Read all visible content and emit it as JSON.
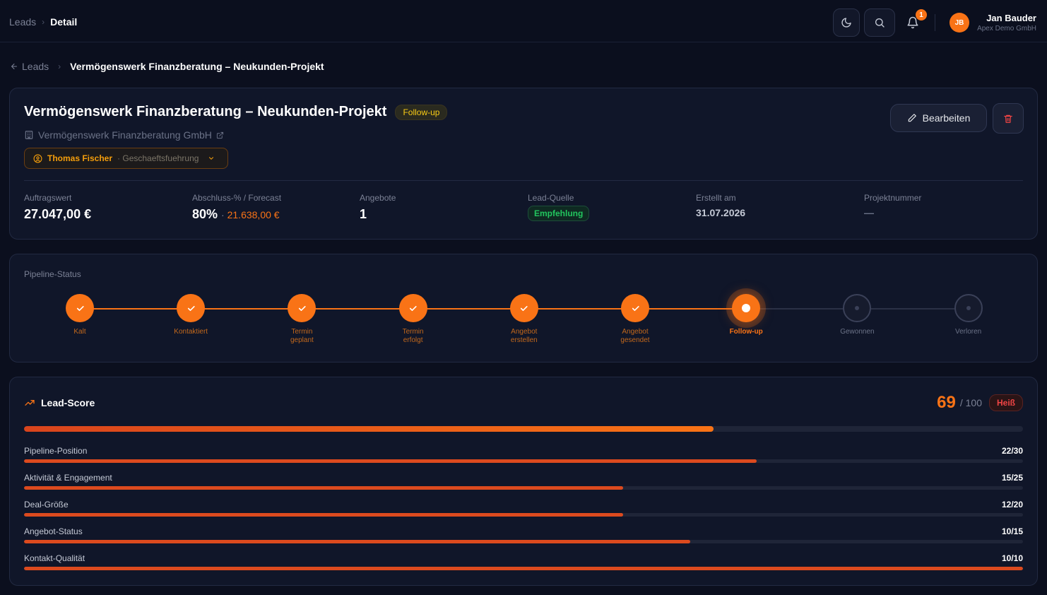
{
  "topbar": {
    "crumb_parent": "Leads",
    "crumb_current": "Detail",
    "notifications_count": "1",
    "user_initials": "JB",
    "user_name": "Jan Bauder",
    "user_company": "Apex Demo GmbH"
  },
  "breadcrumb": {
    "back_label": "Leads",
    "current": "Vermögenswerk Finanzberatung – Neukunden-Projekt"
  },
  "lead": {
    "title": "Vermögenswerk Finanzberatung – Neukunden-Projekt",
    "status": "Follow-up",
    "company": "Vermögenswerk Finanzberatung GmbH",
    "contact_name": "Thomas Fischer",
    "contact_role": "· Geschaeftsfuehrung",
    "edit_label": "Bearbeiten",
    "stats": {
      "auftragswert_label": "Auftragswert",
      "auftragswert": "27.047,00 €",
      "abschluss_label": "Abschluss-% / Forecast",
      "abschluss": "80%",
      "forecast": "21.638,00 €",
      "angebote_label": "Angebote",
      "angebote": "1",
      "quelle_label": "Lead-Quelle",
      "quelle": "Empfehlung",
      "erstellt_label": "Erstellt am",
      "erstellt": "31.07.2026",
      "projektnummer_label": "Projektnummer",
      "projektnummer": "—"
    }
  },
  "pipeline": {
    "label": "Pipeline-Status",
    "stages": [
      {
        "line1": "Kalt",
        "line2": "",
        "state": "done"
      },
      {
        "line1": "Kontaktiert",
        "line2": "",
        "state": "done"
      },
      {
        "line1": "Termin",
        "line2": "geplant",
        "state": "done"
      },
      {
        "line1": "Termin",
        "line2": "erfolgt",
        "state": "done"
      },
      {
        "line1": "Angebot",
        "line2": "erstellen",
        "state": "done"
      },
      {
        "line1": "Angebot",
        "line2": "gesendet",
        "state": "done"
      },
      {
        "line1": "Follow-up",
        "line2": "",
        "state": "current"
      },
      {
        "line1": "Gewonnen",
        "line2": "",
        "state": "todo"
      },
      {
        "line1": "Verloren",
        "line2": "",
        "state": "todo"
      }
    ]
  },
  "lead_score": {
    "title": "Lead-Score",
    "score": "69",
    "max": "/ 100",
    "rating": "Heiß",
    "score_fraction": 0.69,
    "rows": [
      {
        "label": "Pipeline-Position",
        "value": "22/30",
        "fraction": 0.7333
      },
      {
        "label": "Aktivität & Engagement",
        "value": "15/25",
        "fraction": 0.6
      },
      {
        "label": "Deal-Größe",
        "value": "12/20",
        "fraction": 0.6
      },
      {
        "label": "Angebot-Status",
        "value": "10/15",
        "fraction": 0.6667
      },
      {
        "label": "Kontakt-Qualität",
        "value": "10/10",
        "fraction": 1.0
      }
    ]
  },
  "colors": {
    "accent": "#f97316",
    "background": "#0b0f1e",
    "card": "#101629",
    "success": "#22c55e",
    "danger": "#ef4444"
  }
}
